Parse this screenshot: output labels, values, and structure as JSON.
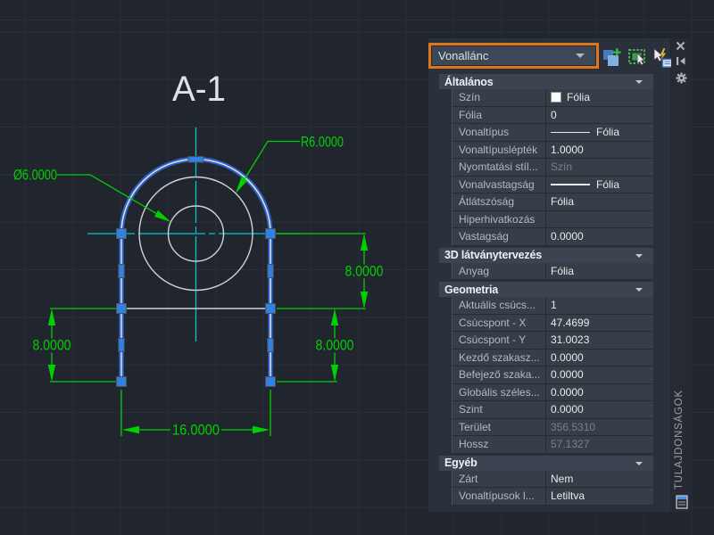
{
  "canvas": {
    "title": "A-1",
    "dims": {
      "radius": "R6.0000",
      "diameter": "Ø6.0000",
      "right": "8.0000",
      "left": "8.0000",
      "inner": "8.0000",
      "bottom": "16.0000"
    }
  },
  "palette": {
    "selector": {
      "value": "Vonallánc"
    },
    "titlebar": {
      "title": "TULAJDONSÁGOK"
    },
    "sections": [
      {
        "title": "Általános",
        "rows": [
          {
            "label": "Szín",
            "value": "Fólia",
            "swatch": true
          },
          {
            "label": "Fólia",
            "value": "0"
          },
          {
            "label": "Vonaltípus",
            "value": "Fólia",
            "line": true
          },
          {
            "label": "Vonaltípuslépték",
            "value": "1.0000"
          },
          {
            "label": "Nyomtatási stíl...",
            "value": "Szín",
            "muted": true
          },
          {
            "label": "Vonalvastagság",
            "value": "Fólia",
            "line": true
          },
          {
            "label": "Átlátszóság",
            "value": "Fólia"
          },
          {
            "label": "Hiperhivatkozás",
            "value": ""
          },
          {
            "label": "Vastagság",
            "value": "0.0000"
          }
        ]
      },
      {
        "title": "3D látványtervezés",
        "rows": [
          {
            "label": "Anyag",
            "value": "Fólia"
          }
        ]
      },
      {
        "title": "Geometria",
        "rows": [
          {
            "label": "Aktuális csúcs...",
            "value": "1"
          },
          {
            "label": "Csúcspont - X",
            "value": "47.4699"
          },
          {
            "label": "Csúcspont - Y",
            "value": "31.0023"
          },
          {
            "label": "Kezdő szakasz...",
            "value": "0.0000"
          },
          {
            "label": "Befejező szaka...",
            "value": "0.0000"
          },
          {
            "label": "Globális széles...",
            "value": "0.0000"
          },
          {
            "label": "Szint",
            "value": "0.0000"
          },
          {
            "label": "Terület",
            "value": "356.5310",
            "muted": true
          },
          {
            "label": "Hossz",
            "value": "57.1327",
            "muted": true
          }
        ]
      },
      {
        "title": "Egyéb",
        "rows": [
          {
            "label": "Zárt",
            "value": "Nem"
          },
          {
            "label": "Vonaltípusok l...",
            "value": "Letiltva"
          }
        ]
      }
    ]
  },
  "colors": {
    "accent_orange": "#e0761c",
    "dimension_green": "#00d000",
    "crosshair_cyan": "#00c9cd",
    "selection_blue": "#2e5fc2",
    "grip_blue": "#2f81e3"
  }
}
